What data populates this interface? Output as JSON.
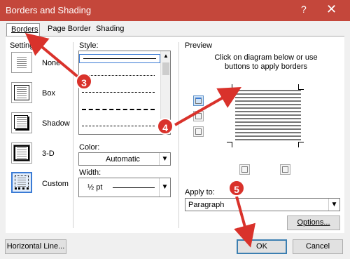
{
  "titlebar": {
    "title": "Borders and Shading",
    "help": "?",
    "close": "✕"
  },
  "tabs": [
    {
      "label": "Borders"
    },
    {
      "label": "Page Border"
    },
    {
      "label": "Shading"
    }
  ],
  "setting": {
    "heading": "Setting:",
    "items": [
      "None",
      "Box",
      "Shadow",
      "3-D",
      "Custom"
    ],
    "selected": "Custom"
  },
  "style": {
    "heading": "Style:"
  },
  "color": {
    "heading": "Color:",
    "value": "Automatic"
  },
  "width": {
    "heading": "Width:",
    "value": "½ pt"
  },
  "preview": {
    "heading": "Preview",
    "instructions": "Click on diagram below or use buttons to apply borders"
  },
  "apply_to": {
    "heading": "Apply to:",
    "value": "Paragraph"
  },
  "buttons": {
    "options": "Options...",
    "horizontal_line": "Horizontal Line...",
    "ok": "OK",
    "cancel": "Cancel"
  },
  "annotations": [
    "3",
    "4",
    "5"
  ],
  "colors": {
    "title_bar": "#c4473b",
    "annotation": "#d9322b",
    "selection": "#3a7bd5"
  }
}
